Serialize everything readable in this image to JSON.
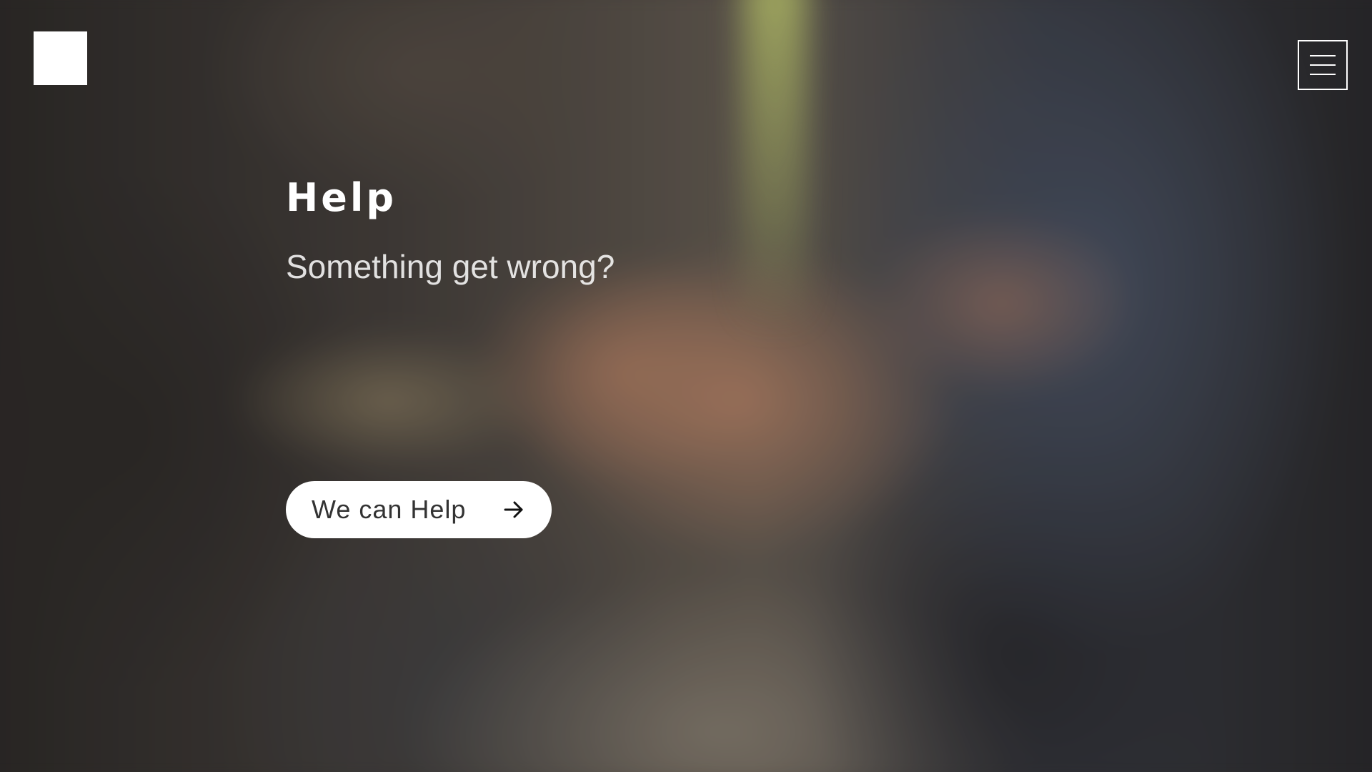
{
  "header": {
    "logo_icon": "square-logo",
    "menu_icon": "hamburger-menu-icon"
  },
  "hero": {
    "title": "Help",
    "subtitle": "Something get wrong?",
    "cta_label": "We can Help",
    "cta_icon": "arrow-right-icon"
  },
  "colors": {
    "text": "#ffffff",
    "button_bg": "#ffffff",
    "button_text": "#333333"
  }
}
